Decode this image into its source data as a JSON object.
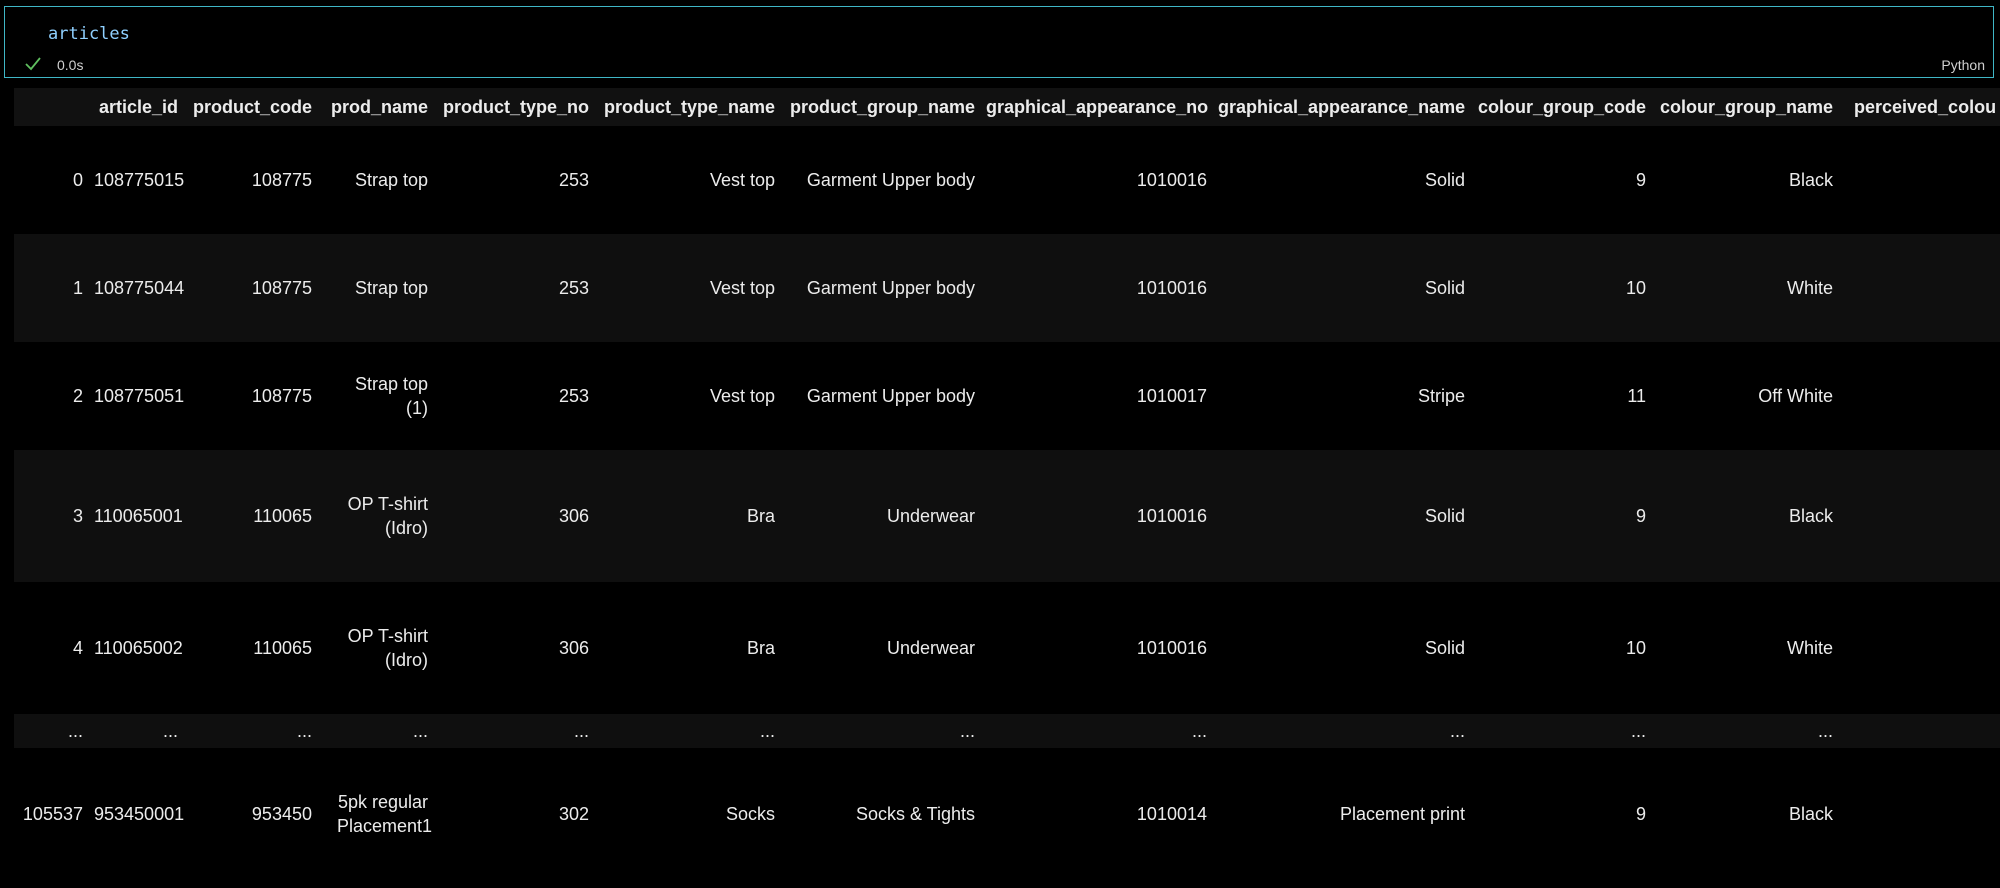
{
  "cell": {
    "code": "articles",
    "status_time": "0.0s",
    "language": "Python"
  },
  "table": {
    "columns": [
      "",
      "article_id",
      "product_code",
      "prod_name",
      "product_type_no",
      "product_type_name",
      "product_group_name",
      "graphical_appearance_no",
      "graphical_appearance_name",
      "colour_group_code",
      "colour_group_name",
      "perceived_colou"
    ],
    "rows": [
      [
        "0",
        "108775015",
        "108775",
        "Strap top",
        "253",
        "Vest top",
        "Garment Upper body",
        "1010016",
        "Solid",
        "9",
        "Black",
        ""
      ],
      [
        "1",
        "108775044",
        "108775",
        "Strap top",
        "253",
        "Vest top",
        "Garment Upper body",
        "1010016",
        "Solid",
        "10",
        "White",
        ""
      ],
      [
        "2",
        "108775051",
        "108775",
        "Strap top (1)",
        "253",
        "Vest top",
        "Garment Upper body",
        "1010017",
        "Stripe",
        "11",
        "Off White",
        ""
      ],
      [
        "3",
        "110065001",
        "110065",
        "OP T-shirt (Idro)",
        "306",
        "Bra",
        "Underwear",
        "1010016",
        "Solid",
        "9",
        "Black",
        ""
      ],
      [
        "4",
        "110065002",
        "110065",
        "OP T-shirt (Idro)",
        "306",
        "Bra",
        "Underwear",
        "1010016",
        "Solid",
        "10",
        "White",
        ""
      ],
      [
        "...",
        "...",
        "...",
        "...",
        "...",
        "...",
        "...",
        "...",
        "...",
        "...",
        "...",
        ""
      ],
      [
        "105537",
        "953450001",
        "953450",
        "5pk regular Placement1",
        "302",
        "Socks",
        "Socks & Tights",
        "1010014",
        "Placement print",
        "9",
        "Black",
        ""
      ]
    ]
  }
}
